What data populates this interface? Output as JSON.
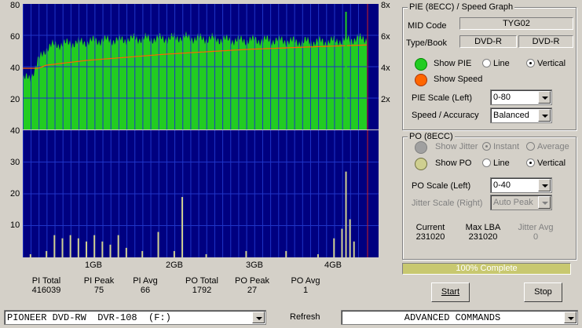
{
  "top_graph": {
    "y_left_ticks": [
      "80",
      "60",
      "40",
      "20"
    ],
    "y_right_ticks": [
      "8x",
      "6x",
      "4x",
      "2x"
    ],
    "ylim_left": [
      0,
      80
    ],
    "ylim_right": [
      0,
      8
    ]
  },
  "bottom_graph": {
    "y_ticks": [
      "40",
      "30",
      "20",
      "10"
    ],
    "ylim": [
      0,
      40
    ],
    "x_ticks": [
      "1GB",
      "2GB",
      "3GB",
      "4GB"
    ]
  },
  "chart_data": [
    {
      "type": "area",
      "title": "",
      "xlabel": "",
      "ylabel": "",
      "x_ticks": [
        "1GB",
        "2GB",
        "3GB",
        "4GB"
      ],
      "x_range_gb": [
        0,
        4.7
      ],
      "ylim": [
        0,
        80
      ],
      "y2lim": [
        0,
        8
      ],
      "series": [
        {
          "values": [
            [
              0.0,
              30
            ],
            [
              0.1,
              31
            ],
            [
              0.2,
              32
            ],
            [
              0.3,
              33
            ],
            [
              0.4,
              44
            ],
            [
              0.5,
              52
            ],
            [
              0.6,
              54
            ],
            [
              0.8,
              55
            ],
            [
              1.0,
              56
            ],
            [
              1.2,
              57
            ],
            [
              1.4,
              57
            ],
            [
              1.6,
              58
            ],
            [
              1.8,
              58
            ],
            [
              2.0,
              58
            ],
            [
              2.2,
              59
            ],
            [
              2.4,
              58
            ],
            [
              2.6,
              58
            ],
            [
              2.8,
              57
            ],
            [
              3.0,
              57
            ],
            [
              3.2,
              57
            ],
            [
              3.4,
              57
            ],
            [
              3.6,
              56
            ],
            [
              3.8,
              56
            ],
            [
              4.0,
              56
            ],
            [
              4.2,
              57
            ],
            [
              4.4,
              58
            ],
            [
              4.6,
              58
            ]
          ]
        },
        {
          "values": [
            [
              0.0,
              3.9
            ],
            [
              0.4,
              3.9
            ],
            [
              0.5,
              4.1
            ],
            [
              1.0,
              4.4
            ],
            [
              1.5,
              4.6
            ],
            [
              2.0,
              4.8
            ],
            [
              2.5,
              4.95
            ],
            [
              3.0,
              5.1
            ],
            [
              3.5,
              5.2
            ],
            [
              4.0,
              5.3
            ],
            [
              4.6,
              5.4
            ]
          ]
        }
      ]
    },
    {
      "type": "bar",
      "title": "",
      "xlabel": "",
      "ylabel": "",
      "x_ticks": [
        "1GB",
        "2GB",
        "3GB",
        "4GB"
      ],
      "ylim": [
        0,
        40
      ],
      "values": [
        [
          0.05,
          1
        ],
        [
          0.3,
          1
        ],
        [
          0.5,
          2
        ],
        [
          0.6,
          7
        ],
        [
          0.7,
          6
        ],
        [
          0.8,
          7
        ],
        [
          0.9,
          6
        ],
        [
          1.0,
          5
        ],
        [
          1.1,
          7
        ],
        [
          1.2,
          5
        ],
        [
          1.3,
          4
        ],
        [
          1.4,
          7
        ],
        [
          1.5,
          3
        ],
        [
          1.7,
          2
        ],
        [
          1.9,
          8
        ],
        [
          2.1,
          2
        ],
        [
          2.2,
          19
        ],
        [
          2.5,
          1
        ],
        [
          3.0,
          2
        ],
        [
          3.5,
          2
        ],
        [
          3.9,
          1
        ],
        [
          4.1,
          6
        ],
        [
          4.2,
          9
        ],
        [
          4.25,
          27
        ],
        [
          4.3,
          12
        ],
        [
          4.35,
          5
        ]
      ]
    }
  ],
  "stats": [
    {
      "label": "PI Total",
      "value": "416039"
    },
    {
      "label": "PI Peak",
      "value": "75"
    },
    {
      "label": "PI Avg",
      "value": "66"
    },
    {
      "label": "PO Total",
      "value": "1792"
    },
    {
      "label": "PO Peak",
      "value": "27"
    },
    {
      "label": "PO Avg",
      "value": "1"
    }
  ],
  "pie_panel": {
    "title": "PIE (8ECC) / Speed Graph",
    "mid_label": "MID Code",
    "mid_value": "TYG02",
    "typebook_label": "Type/Book",
    "type_value": "DVD-R",
    "book_value": "DVD-R",
    "show_pie": "Show PIE",
    "line": "Line",
    "vertical": "Vertical",
    "show_speed": "Show Speed",
    "pie_scale_label": "PIE Scale (Left)",
    "pie_scale_value": "0-80",
    "speed_label": "Speed / Accuracy",
    "speed_value": "Balanced",
    "pie_color": "#22cc22",
    "speed_color": "#ff6600"
  },
  "po_panel": {
    "title": "PO (8ECC)",
    "show_jitter": "Show Jitter",
    "instant": "Instant",
    "average": "Average",
    "show_po": "Show PO",
    "line": "Line",
    "vertical": "Vertical",
    "po_scale_label": "PO Scale (Left)",
    "po_scale_value": "0-40",
    "jitter_scale_label": "Jitter Scale (Right)",
    "jitter_scale_value": "Auto Peak",
    "current_label": "Current",
    "current_value": "231020",
    "maxlba_label": "Max LBA",
    "maxlba_value": "231020",
    "jitter_avg_label": "Jitter Avg",
    "jitter_avg_value": "0",
    "po_color": "#cfcf90"
  },
  "progress": {
    "text": "100% Complete",
    "fraction": 1.0,
    "color": "#c8c870"
  },
  "buttons": {
    "start": "Start",
    "stop": "Stop",
    "refresh": "Refresh"
  },
  "drive": {
    "value": "PIONEER DVD-RW  DVR-108  (F:)"
  },
  "advanced": {
    "value": "ADVANCED COMMANDS"
  }
}
